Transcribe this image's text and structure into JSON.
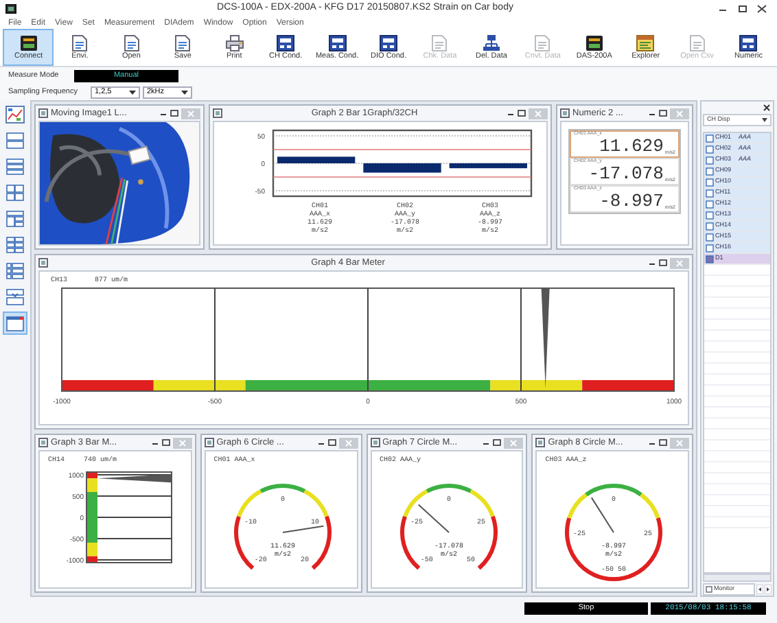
{
  "window": {
    "title": "DCS-100A - EDX-200A - KFG D17 20150807.KS2 Strain on Car body"
  },
  "menu": [
    "File",
    "Edit",
    "View",
    "Set",
    "Measurement",
    "DIAdem",
    "Window",
    "Option",
    "Version"
  ],
  "toolbar": [
    {
      "label": "Connect",
      "kind": "device",
      "selected": true,
      "disabled": false
    },
    {
      "label": "Envi.",
      "kind": "doc",
      "selected": false,
      "disabled": false
    },
    {
      "label": "Open",
      "kind": "doc",
      "selected": false,
      "disabled": false
    },
    {
      "label": "Save",
      "kind": "doc",
      "selected": false,
      "disabled": false
    },
    {
      "label": "Print",
      "kind": "printer",
      "selected": false,
      "disabled": false
    },
    {
      "label": "CH Cond.",
      "kind": "panel",
      "selected": false,
      "disabled": false
    },
    {
      "label": "Meas. Cond.",
      "kind": "panel",
      "selected": false,
      "disabled": false
    },
    {
      "label": "DIO Cond.",
      "kind": "panel",
      "selected": false,
      "disabled": false
    },
    {
      "label": "Chk. Data",
      "kind": "doc",
      "selected": false,
      "disabled": true
    },
    {
      "label": "Del. Data",
      "kind": "tree",
      "selected": false,
      "disabled": false
    },
    {
      "label": "Cnvt. Data",
      "kind": "doc",
      "selected": false,
      "disabled": true
    },
    {
      "label": "DAS-200A",
      "kind": "device",
      "selected": false,
      "disabled": false
    },
    {
      "label": "Explorer",
      "kind": "map",
      "selected": false,
      "disabled": false
    },
    {
      "label": "Open Csv",
      "kind": "doc",
      "selected": false,
      "disabled": true
    },
    {
      "label": "Numeric",
      "kind": "panel",
      "selected": false,
      "disabled": false
    }
  ],
  "measure_mode": {
    "label": "Measure Mode",
    "value": "Manual"
  },
  "sampling_frequency": {
    "label": "Sampling Frequency",
    "value": "1,2,5",
    "range": "2kHz"
  },
  "layout_tools": [
    {
      "kind": "chart",
      "selected": false
    },
    {
      "kind": "rows2",
      "selected": false
    },
    {
      "kind": "rows3",
      "selected": false
    },
    {
      "kind": "grid4",
      "selected": false
    },
    {
      "kind": "mixed",
      "selected": false
    },
    {
      "kind": "grid6",
      "selected": false
    },
    {
      "kind": "table",
      "selected": false
    },
    {
      "kind": "insert",
      "selected": false
    },
    {
      "kind": "window",
      "selected": true
    }
  ],
  "window_rows": [
    {
      "windows": [
        {
          "kind": "picture",
          "title": "Moving Image1 L..."
        },
        {
          "kind": "bar_graph",
          "title": "Graph 2 Bar 1Graph/32CH",
          "chart_data": {
            "type": "bar",
            "values": [
              12,
              -17,
              -9
            ],
            "ylim": [
              -60,
              60
            ],
            "yticks": [
              50,
              0,
              -50
            ],
            "grid": true
          },
          "channels": [
            {
              "channel": "CH01",
              "name": "AAA_x",
              "value": "11.629",
              "unit": "m/s2"
            },
            {
              "channel": "CH02",
              "name": "AAA_y",
              "value": "-17.078",
              "unit": "m/s2"
            },
            {
              "channel": "CH03",
              "name": "AAA_z",
              "value": "-8.997",
              "unit": "m/s2"
            }
          ]
        },
        {
          "kind": "numeric",
          "title": "Numeric 2 ...",
          "readings": [
            {
              "label": "CH01 AAA_x",
              "value": "11.629",
              "unit": "m/s2",
              "selected": true
            },
            {
              "label": "CH02 AAA_y",
              "value": "-17.078",
              "unit": "m/s2",
              "selected": false
            },
            {
              "label": "CH03 AAA_z",
              "value": "-8.997",
              "unit": "m/s2",
              "selected": false
            }
          ]
        }
      ]
    },
    {
      "windows": [
        {
          "kind": "bar_meter_h",
          "title": "Graph 4 Bar Meter",
          "channel": "CH13",
          "reading": "877 um/m",
          "ticks": [
            "-1000",
            "-500",
            "0",
            "500",
            "1000"
          ]
        }
      ]
    },
    {
      "windows": [
        {
          "kind": "bar_meter_v",
          "title": "Graph 3 Bar M...",
          "channel": "CH14",
          "reading": "740 um/m",
          "ticks": [
            "1000",
            "500",
            "0",
            "-500",
            "-1000"
          ]
        },
        {
          "kind": "circle_meter",
          "title": "Graph 6 Circle ...",
          "channel": "CH01 AAA_x",
          "ticks": [
            "-20",
            "-10",
            "0",
            "10",
            "20"
          ],
          "value": "11.629",
          "unit": "m/s2",
          "closed": false
        },
        {
          "kind": "circle_meter",
          "title": "Graph 7 Circle M...",
          "channel": "CH02 AAA_y",
          "ticks": [
            "-50",
            "-25",
            "0",
            "25",
            "50"
          ],
          "value": "-17.078",
          "unit": "m/s2",
          "closed": false
        },
        {
          "kind": "circle_meter",
          "title": "Graph 8 Circle M...",
          "channel": "CH03 AAA_z",
          "ticks": [
            "-50 50",
            "-25",
            "0",
            "25"
          ],
          "value": "-8.997",
          "unit": "m/s2",
          "closed": true
        }
      ]
    }
  ],
  "channel_panel": {
    "dropdown": "CH Disp",
    "items": [
      {
        "label": "CH01",
        "name": "AAA",
        "selected": false
      },
      {
        "label": "CH02",
        "name": "AAA",
        "selected": false
      },
      {
        "label": "CH03",
        "name": "AAA",
        "selected": false
      },
      {
        "label": "CH09",
        "selected": false
      },
      {
        "label": "CH10",
        "selected": false
      },
      {
        "label": "CH11",
        "selected": false
      },
      {
        "label": "CH12",
        "selected": false
      },
      {
        "label": "CH13",
        "selected": false
      },
      {
        "label": "CH14",
        "selected": false
      },
      {
        "label": "CH15",
        "selected": false
      },
      {
        "label": "CH16",
        "selected": false
      },
      {
        "label": "D1",
        "selected": true
      }
    ],
    "tab": "Monitor"
  },
  "status_bar": {
    "state": "Stop",
    "datetime": "2015/08/03 18:15:58"
  }
}
